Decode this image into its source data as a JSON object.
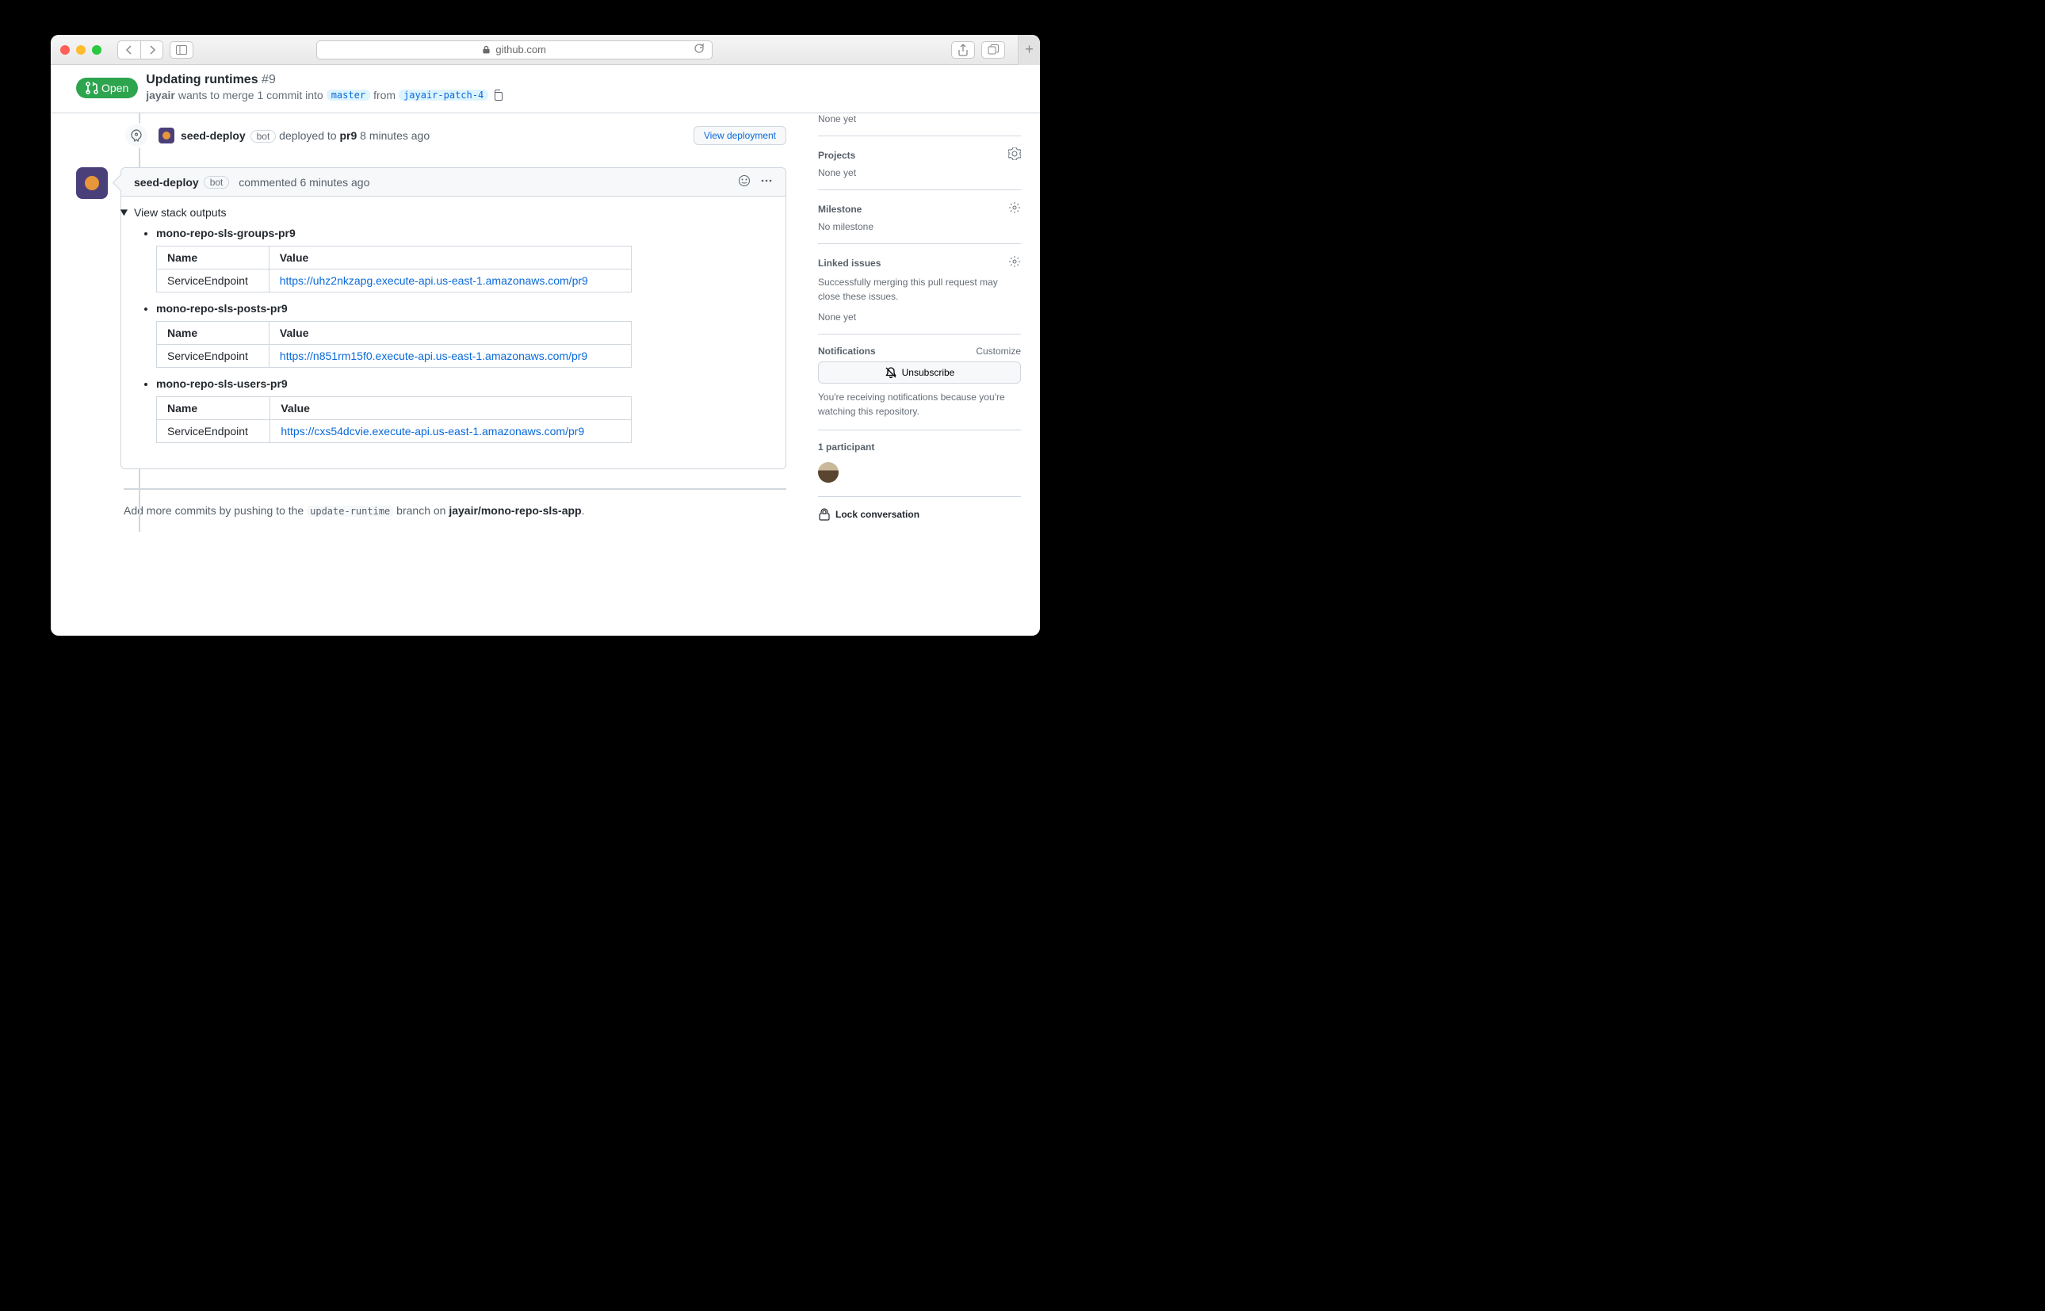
{
  "browser": {
    "domain": "github.com"
  },
  "pr": {
    "state": "Open",
    "title": "Updating runtimes",
    "number": "#9",
    "author": "jayair",
    "merge_phrase_1": "wants to merge 1 commit into",
    "base_branch": "master",
    "merge_phrase_2": "from",
    "head_branch": "jayair-patch-4"
  },
  "event": {
    "actor": "seed-deploy",
    "bot_label": "bot",
    "deployed_prefix": "deployed to",
    "deployed_target": "pr9",
    "deployed_time": "8 minutes ago",
    "view_deployment": "View deployment"
  },
  "comment": {
    "actor": "seed-deploy",
    "bot_label": "bot",
    "commented_label": "commented",
    "time": "6 minutes ago",
    "summary": "View stack outputs",
    "table_headers": {
      "name": "Name",
      "value": "Value"
    },
    "stacks": [
      {
        "name": "mono-repo-sls-groups-pr9",
        "row_name": "ServiceEndpoint",
        "row_value": "https://uhz2nkzapg.execute-api.us-east-1.amazonaws.com/pr9"
      },
      {
        "name": "mono-repo-sls-posts-pr9",
        "row_name": "ServiceEndpoint",
        "row_value": "https://n851rm15f0.execute-api.us-east-1.amazonaws.com/pr9"
      },
      {
        "name": "mono-repo-sls-users-pr9",
        "row_name": "ServiceEndpoint",
        "row_value": "https://cxs54dcvie.execute-api.us-east-1.amazonaws.com/pr9"
      }
    ]
  },
  "more_commits": {
    "prefix": "Add more commits by pushing to the",
    "branch": "update-runtime",
    "middle": "branch on",
    "repo": "jayair/mono-repo-sls-app",
    "suffix": "."
  },
  "sidebar": {
    "assignees_value": "None yet",
    "projects_label": "Projects",
    "projects_value": "None yet",
    "milestone_label": "Milestone",
    "milestone_value": "No milestone",
    "linked_label": "Linked issues",
    "linked_desc": "Successfully merging this pull request may close these issues.",
    "linked_value": "None yet",
    "notifications_label": "Notifications",
    "customize": "Customize",
    "unsubscribe": "Unsubscribe",
    "notif_desc": "You're receiving notifications because you're watching this repository.",
    "participants_label": "1 participant",
    "lock": "Lock conversation"
  }
}
